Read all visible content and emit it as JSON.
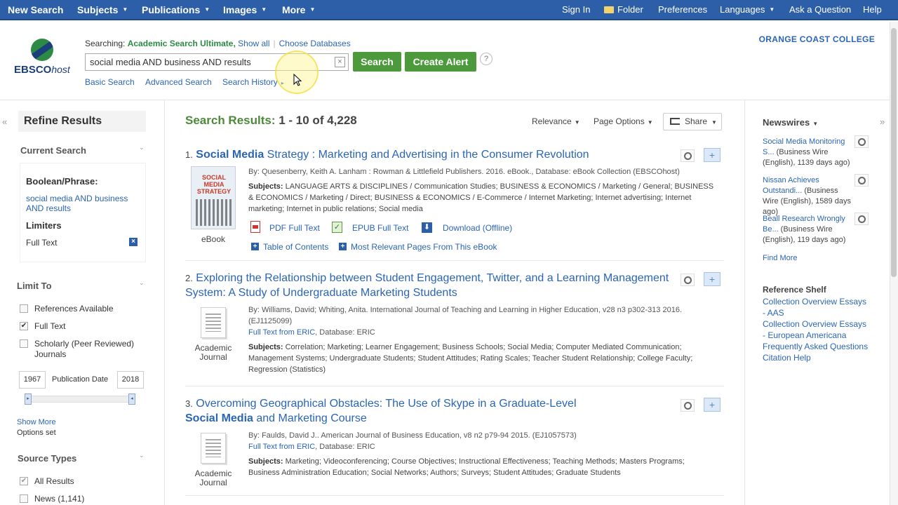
{
  "topnav": {
    "left": [
      {
        "label": "New Search",
        "caret": false
      },
      {
        "label": "Subjects",
        "caret": true
      },
      {
        "label": "Publications",
        "caret": true
      },
      {
        "label": "Images",
        "caret": true
      },
      {
        "label": "More",
        "caret": true
      }
    ],
    "sign_in": "Sign In",
    "folder": "Folder",
    "preferences": "Preferences",
    "languages": "Languages",
    "ask": "Ask a Question",
    "help": "Help"
  },
  "logo": {
    "brand": "EBSCO",
    "suffix": "host"
  },
  "search": {
    "searching_label": "Searching:",
    "database": "Academic Search Ultimate,",
    "show_all": "Show all",
    "choose_databases": "Choose Databases",
    "query": "social media AND business AND results",
    "clear": "×",
    "search_button": "Search",
    "create_alert": "Create Alert",
    "help": "?",
    "basic": "Basic Search",
    "advanced": "Advanced Search",
    "history": "Search History",
    "history_caret": "▸"
  },
  "institution": "ORANGE COAST COLLEGE",
  "left": {
    "collapse": "«",
    "refine_title": "Refine Results",
    "current_search": "Current Search",
    "boolean_label": "Boolean/Phrase:",
    "boolean_value": "social media AND business AND results",
    "limiters_label": "Limiters",
    "limiter": "Full Text",
    "remove": "×",
    "limit_to": "Limit To",
    "caret": "⌄",
    "options": [
      {
        "label": "References Available",
        "checked": false
      },
      {
        "label": "Full Text",
        "checked": true
      },
      {
        "label": "Scholarly (Peer Reviewed) Journals",
        "checked": false
      }
    ],
    "year_from": "1967",
    "pub_date": "Publication Date",
    "year_to": "2018",
    "show_more": "Show More",
    "options_set": "Options set",
    "source_types": "Source Types",
    "sources": [
      {
        "label": "All Results",
        "checked": true
      },
      {
        "label": "News (1,141)",
        "checked": false
      }
    ]
  },
  "results_header": {
    "label": "Search Results:",
    "range": "1 - 10 of 4,228",
    "relevance": "Relevance",
    "page_options": "Page Options",
    "share": "Share"
  },
  "results": [
    {
      "num": "1.",
      "title_b": "Social Media",
      "title_rest": " Strategy : Marketing and Advertising in the Consumer Revolution",
      "meta": "By: Quesenberry, Keith A. Lanham : Rowman & Littlefield Publishers. 2016. eBook., Database: eBook Collection (EBSCOhost)",
      "subjects_label": "Subjects:",
      "subjects": "LANGUAGE ARTS & DISCIPLINES / Communication Studies; BUSINESS & ECONOMICS / Marketing / General; BUSINESS & ECONOMICS / Marketing / Direct; BUSINESS & ECONOMICS / E-Commerce / Internet Marketing; Internet advertising; Internet marketing; Internet in public relations; Social media",
      "cover_title": "SOCIAL MEDIA STRATEGY",
      "type": "eBook",
      "pdf": "PDF Full Text",
      "epub": "EPUB Full Text",
      "download": "Download (Offline)",
      "toc": "Table of Contents",
      "relevant_pages": "Most Relevant Pages From This eBook"
    },
    {
      "num": "2.",
      "title_b": "",
      "title_rest": "Exploring the Relationship between Student Engagement, Twitter, and a Learning Management System: A Study of Undergraduate Marketing Students",
      "meta": "By: Williams, David; Whiting, Anita. International Journal of Teaching and Learning in Higher Education, v28 n3 p302-313 2016. (EJ1125099)",
      "fulltext": "Full Text from ERIC",
      "db": ", Database: ERIC",
      "subjects_label": "Subjects:",
      "subjects": "Correlation; Marketing; Learner Engagement; Business Schools; Social Media; Computer Mediated Communication; Management Systems; Undergraduate Students; Student Attitudes; Rating Scales; Teacher Student Relationship; College Faculty; Regression (Statistics)",
      "type": "Academic Journal"
    },
    {
      "num": "3.",
      "title_pre": "Overcoming Geographical Obstacles: The Use of Skype in a Graduate-Level",
      "title_b": "Social Media",
      "title_rest": " and Marketing Course",
      "meta": "By: Faulds, David J.. American Journal of Business Education, v8 n2 p79-94 2015. (EJ1057573)",
      "fulltext": "Full Text from ERIC",
      "db": ", Database: ERIC",
      "subjects_label": "Subjects:",
      "subjects": "Marketing; Videoconferencing; Course Objectives; Instructional Effectiveness; Teaching Methods; Masters Programs; Business Administration Education; Social Networks; Authors; Surveys; Student Attitudes; Graduate Students",
      "type": "Academic Journal"
    }
  ],
  "right": {
    "collapse": "»",
    "newswires": "Newswires",
    "items": [
      {
        "link": "Social Media Monitoring S...",
        "rest": " (Business Wire (English), 1139 days ago)"
      },
      {
        "link": "Nissan Achieves Outstandi...",
        "rest": " (Business Wire (English), 1589 days ago)"
      },
      {
        "link": "Beall Research Wrongly Be...",
        "rest": " (Business Wire (English), 119 days ago)"
      }
    ],
    "find_more": "Find More",
    "ref_shelf": "Reference Shelf",
    "ref_links": [
      "Collection Overview Essays - AAS",
      "Collection Overview Essays - European Americana",
      "Frequently Asked Questions",
      "Citation Help"
    ]
  }
}
